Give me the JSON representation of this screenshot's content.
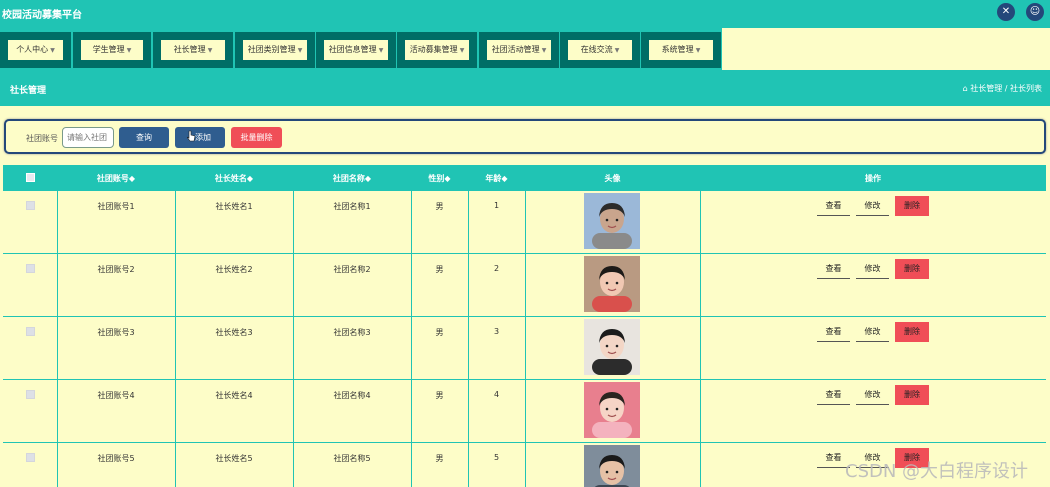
{
  "app": {
    "title": "校园活动募集平台"
  },
  "topbar_icons": [
    "expand-icon",
    "user-icon"
  ],
  "nav": [
    {
      "label": "个人中心"
    },
    {
      "label": "学生管理"
    },
    {
      "label": "社长管理"
    },
    {
      "label": "社团类别管理"
    },
    {
      "label": "社团信息管理"
    },
    {
      "label": "活动募集管理"
    },
    {
      "label": "社团活动管理"
    },
    {
      "label": "在线交流"
    },
    {
      "label": "系统管理"
    }
  ],
  "page": {
    "title": "社长管理",
    "breadcrumb": "社长管理 / 社长列表"
  },
  "search": {
    "label": "社团账号",
    "placeholder": "请输入社团",
    "query_btn": "查询",
    "add_btn": "添加",
    "batch_delete_btn": "批量删除"
  },
  "table": {
    "headers": [
      "社团账号◆",
      "社长姓名◆",
      "社团名称◆",
      "性别◆",
      "年龄◆",
      "头像",
      "操作"
    ],
    "actions": {
      "view": "查看",
      "edit": "修改",
      "delete": "删除"
    },
    "rows": [
      {
        "account": "社团账号1",
        "name": "社长姓名1",
        "club": "社团名称1",
        "gender": "男",
        "age": "1"
      },
      {
        "account": "社团账号2",
        "name": "社长姓名2",
        "club": "社团名称2",
        "gender": "男",
        "age": "2"
      },
      {
        "account": "社团账号3",
        "name": "社长姓名3",
        "club": "社团名称3",
        "gender": "男",
        "age": "3"
      },
      {
        "account": "社团账号4",
        "name": "社长姓名4",
        "club": "社团名称4",
        "gender": "男",
        "age": "4"
      },
      {
        "account": "社团账号5",
        "name": "社长姓名5",
        "club": "社团名称5",
        "gender": "男",
        "age": "5"
      }
    ]
  },
  "watermark": "CSDN @大白程序设计",
  "colors": {
    "teal": "#20c4b4",
    "cream": "#fdfdc8",
    "navy": "#2f5d8f",
    "red": "#f04e57"
  }
}
